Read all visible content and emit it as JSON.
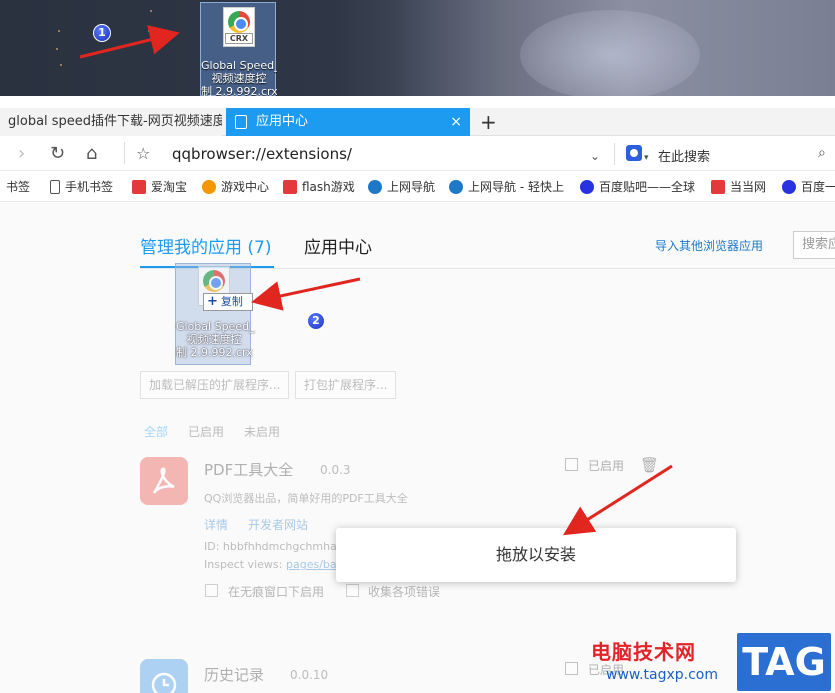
{
  "desktop": {
    "file_label": "Global Speed_\n视频速度控\n制 2.9.992.crx",
    "file_badge": "CRX",
    "step1": "1"
  },
  "browser": {
    "tabs": [
      {
        "label": "global speed插件下载-网页视频速度"
      },
      {
        "label": "应用中心"
      }
    ],
    "new_tab": "+",
    "tab_close": "×",
    "url": "qqbrowser://extensions/",
    "search_placeholder": "在此搜索"
  },
  "bookmarks": [
    {
      "label": "书签",
      "color": "#ffffff"
    },
    {
      "label": "手机书签",
      "color": "#555555"
    },
    {
      "label": "爱淘宝",
      "color": "#e4393c"
    },
    {
      "label": "游戏中心",
      "color": "#f39800"
    },
    {
      "label": "flash游戏",
      "color": "#e4393c"
    },
    {
      "label": "上网导航",
      "color": "#1d78c8"
    },
    {
      "label": "上网导航 - 轻快上",
      "color": "#1d78c8"
    },
    {
      "label": "百度贴吧——全球",
      "color": "#2932e1"
    },
    {
      "label": "当当网",
      "color": "#e4393c"
    },
    {
      "label": "百度一",
      "color": "#2932e1"
    }
  ],
  "extensions_page": {
    "tab_manage": "管理我的应用 (7)",
    "tab_center": "应用中心",
    "import_link": "导入其他浏览器应用",
    "search_placeholder": "搜索应",
    "load_button": "加载已解压的扩展程序...",
    "pack_button": "打包扩展程序...",
    "filters": [
      "全部",
      "已启用",
      "未启用"
    ],
    "ext1": {
      "title": "PDF工具大全",
      "version": "0.0.3",
      "desc": "QQ浏览器出品，简单好用的PDF工具大全",
      "link_details": "详情",
      "link_dev": "开发者网站",
      "id": "ID: hbbfhhdmchgchmhar",
      "inspect": "Inspect views:",
      "inspect_link": "pages/ba",
      "enabled": "已启用",
      "incognito": "在无痕窗口下启用",
      "collect_errors": "收集各项错误"
    },
    "ext2": {
      "title": "历史记录",
      "version": "0.0.10",
      "enabled": "已启用"
    }
  },
  "drag": {
    "ghost_label": "Global Speed_\n视频速度控\n制 2.9.992.crx",
    "copy_tip": "复制",
    "copy_plus": "+",
    "step2": "2"
  },
  "drop_overlay": "拖放以安装",
  "watermark": {
    "title": "电脑技术网",
    "url": "www.tagxp.com",
    "tag": "TAG"
  },
  "colors": {
    "accent": "#1d9bf0",
    "arrow": "#e0261f"
  }
}
